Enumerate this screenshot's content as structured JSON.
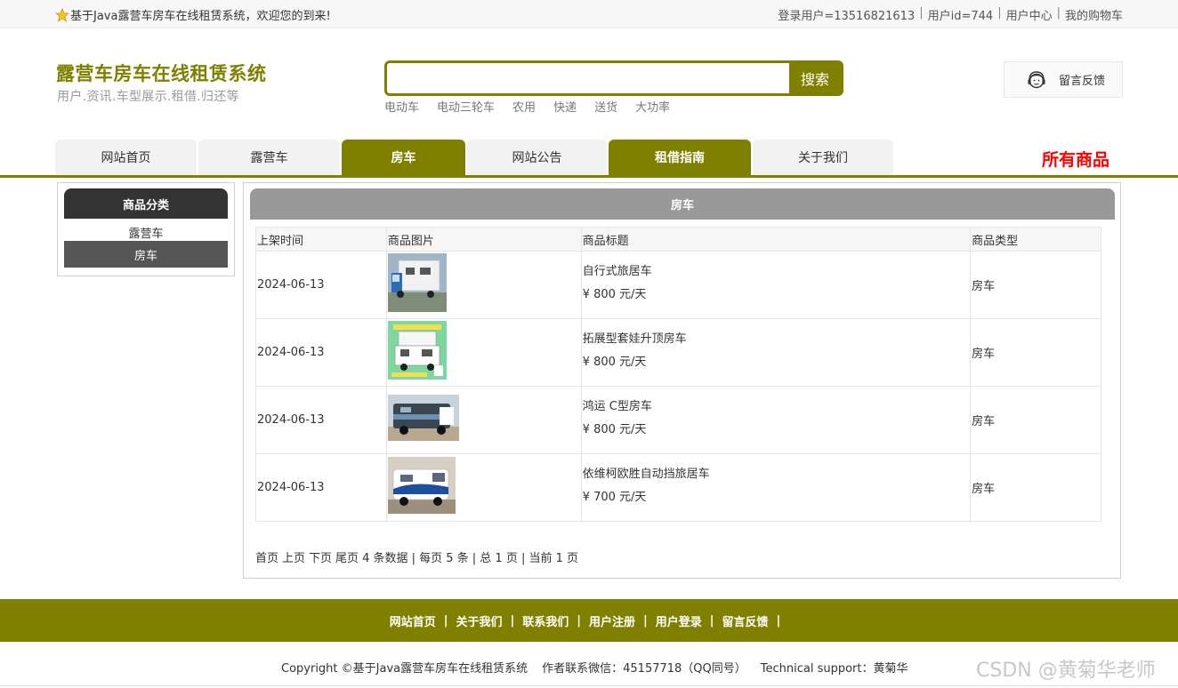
{
  "topbar": {
    "welcome": "基于Java露营车房车在线租赁系统，欢迎您的到来!",
    "login_user": "登录用户=13516821613",
    "user_id": "用户id=744",
    "user_center": "用户中心",
    "cart": "我的购物车",
    "separator": "|"
  },
  "header": {
    "title": "露营车房车在线租赁系统",
    "subtitle": "用户.资讯.车型展示.租借.归还等",
    "search": {
      "value": "",
      "placeholder": "",
      "button": "搜索"
    },
    "hot_keys": [
      "电动车",
      "电动三轮车",
      "农用",
      "快递",
      "送货",
      "大功率"
    ],
    "feedback": "留言反馈"
  },
  "nav": {
    "items": [
      {
        "label": "网站首页",
        "active": false
      },
      {
        "label": "露营车",
        "active": false
      },
      {
        "label": "房车",
        "active": true
      },
      {
        "label": "网站公告",
        "active": false
      },
      {
        "label": "租借指南",
        "active": true
      },
      {
        "label": "关于我们",
        "active": false
      }
    ],
    "all_goods": "所有商品"
  },
  "sidebar": {
    "title": "商品分类",
    "items": [
      "露营车",
      "房车"
    ],
    "selected": "房车"
  },
  "main": {
    "title": "房车",
    "columns": [
      "上架时间",
      "商品图片",
      "商品标题",
      "商品类型"
    ],
    "rows": [
      {
        "date": "2024-06-13",
        "title": "自行式旅居车",
        "price": "¥ 800 元/天",
        "type": "房车"
      },
      {
        "date": "2024-06-13",
        "title": "拓展型套娃升顶房车",
        "price": "¥ 800 元/天",
        "type": "房车"
      },
      {
        "date": "2024-06-13",
        "title": "鸿运 C型房车",
        "price": "¥ 800 元/天",
        "type": "房车"
      },
      {
        "date": "2024-06-13",
        "title": "依维柯欧胜自动挡旅居车",
        "price": "¥ 700 元/天",
        "type": "房车"
      }
    ],
    "pager": {
      "first": "首页",
      "prev": "上页",
      "next": "下页",
      "last": "尾页",
      "info": "4 条数据 | 每页 5 条 | 总 1 页 | 当前 1 页"
    }
  },
  "footer": {
    "links": [
      "网站首页",
      "关于我们",
      "联系我们",
      "用户注册",
      "用户登录",
      "留言反馈"
    ],
    "separator": "|",
    "copyright": "Copyright ©基于Java露营车房车在线租赁系统",
    "author": "作者联系微信：45157718（QQ同号）",
    "support": "Technical support：黄菊华",
    "watermark": "CSDN @黄菊华老师"
  },
  "colors": {
    "accent": "#808000",
    "price_highlight": "#ff0000",
    "sidebar_dark": "#333333",
    "panel_gray": "#999999"
  }
}
